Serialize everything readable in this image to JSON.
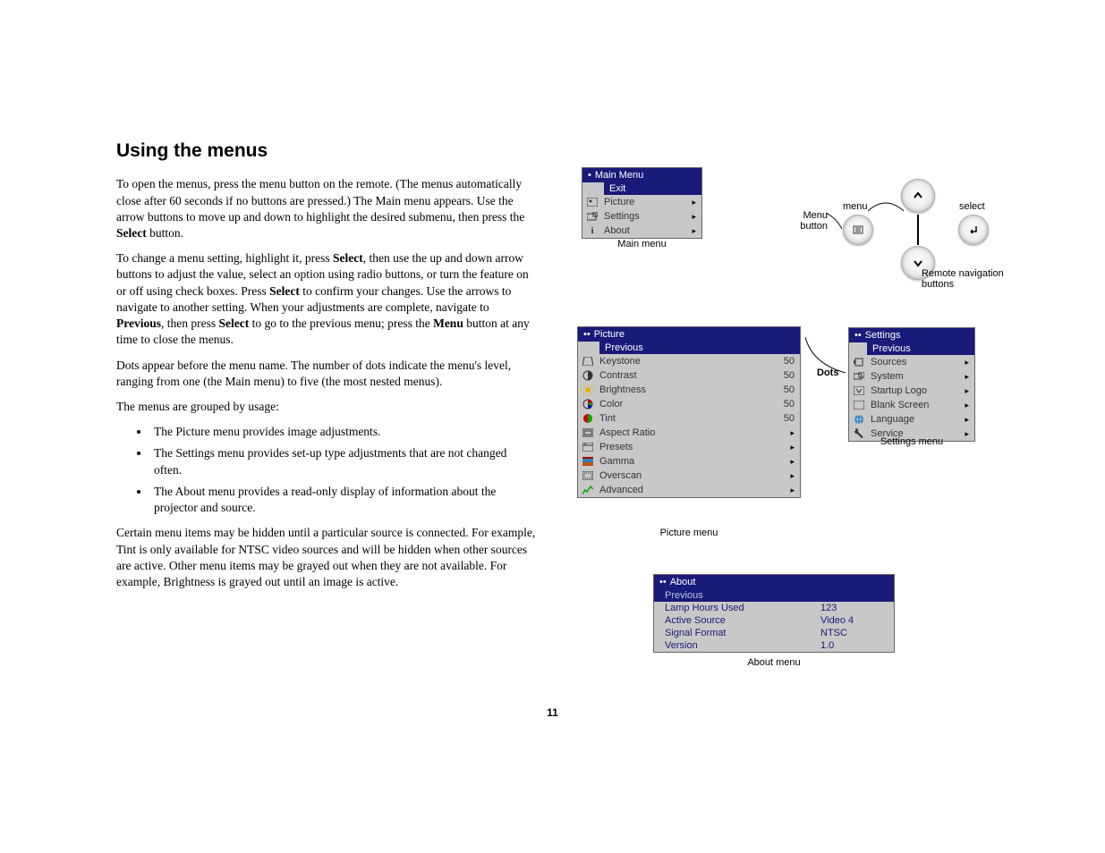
{
  "heading": "Using the menus",
  "p1a": "To open the menus, press the menu button on the remote. (The menus automatically close after 60 seconds if no buttons are pressed.) The Main menu appears. Use the arrow buttons to move up and down to highlight the desired submenu, then press the ",
  "p1b": "Select",
  "p1c": " button.",
  "p2a": "To change a menu setting, highlight it, press ",
  "p2b": "Select",
  "p2c": ", then use the up and down arrow buttons to adjust the value, select an option using radio buttons, or turn the feature on or off using check boxes. Press ",
  "p2d": "Select",
  "p2e": " to confirm your changes. Use the arrows to navigate to another setting. When your adjustments are complete, navigate to ",
  "p2f": "Previous",
  "p2g": ", then press ",
  "p2h": "Select",
  "p2i": " to go to the previous menu; press the ",
  "p2j": "Menu",
  "p2k": " button at any time to close the menus.",
  "p3": "Dots appear before the menu name. The number of dots indicate the menu's level, ranging from one (the Main menu) to five (the most nested menus).",
  "p4": "The menus are grouped by usage:",
  "li1": "The Picture menu provides image adjustments.",
  "li2": "The Settings menu provides set-up type adjustments that are not changed often.",
  "li3": "The About menu provides a read-only display of information about the projector and source.",
  "p5": "Certain menu items may be hidden until a particular source is connected. For example, Tint is only available for NTSC video sources and will be hidden when other sources are active. Other menu items may be grayed out when they are not available. For example, Brightness is grayed out until an image is active.",
  "page_number": "11",
  "remote_labels": {
    "menu": "menu",
    "select": "select",
    "menu_button": "Menu\nbutton",
    "caption": "Remote navigation buttons"
  },
  "main_menu": {
    "title": "Main Menu",
    "highlight": "Exit",
    "items": [
      {
        "label": "Picture"
      },
      {
        "label": "Settings"
      },
      {
        "label": "About"
      }
    ],
    "caption": "Main menu"
  },
  "picture_menu": {
    "title": "Picture",
    "highlight": "Previous",
    "items": [
      {
        "label": "Keystone",
        "value": "50"
      },
      {
        "label": "Contrast",
        "value": "50"
      },
      {
        "label": "Brightness",
        "value": "50"
      },
      {
        "label": "Color",
        "value": "50"
      },
      {
        "label": "Tint",
        "value": "50"
      },
      {
        "label": "Aspect Ratio",
        "arrow": true
      },
      {
        "label": "Presets",
        "arrow": true
      },
      {
        "label": "Gamma",
        "arrow": true
      },
      {
        "label": "Overscan",
        "arrow": true
      },
      {
        "label": "Advanced",
        "arrow": true
      }
    ],
    "caption": "Picture menu",
    "dots_label": "Dots"
  },
  "settings_menu": {
    "title": "Settings",
    "highlight": "Previous",
    "items": [
      {
        "label": "Sources"
      },
      {
        "label": "System"
      },
      {
        "label": "Startup Logo"
      },
      {
        "label": "Blank Screen"
      },
      {
        "label": "Language"
      },
      {
        "label": "Service"
      }
    ],
    "caption": "Settings menu"
  },
  "about_menu": {
    "title": "About",
    "highlight": "Previous",
    "rows": [
      {
        "k": "Lamp Hours Used",
        "v": "123"
      },
      {
        "k": "Active Source",
        "v": "Video 4"
      },
      {
        "k": "Signal Format",
        "v": "NTSC"
      },
      {
        "k": "Version",
        "v": "1.0"
      }
    ],
    "caption": "About menu"
  }
}
